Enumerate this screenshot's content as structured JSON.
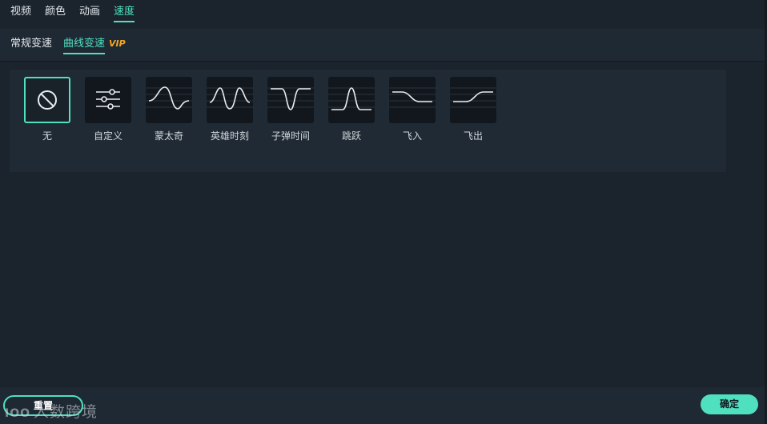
{
  "top_tabs": [
    {
      "label": "视频"
    },
    {
      "label": "颜色"
    },
    {
      "label": "动画"
    },
    {
      "label": "速度"
    }
  ],
  "sub_tabs": [
    {
      "label": "常规变速"
    },
    {
      "label": "曲线变速"
    }
  ],
  "vip_badge": "VIP",
  "presets": [
    {
      "label": "无",
      "icon": "none-icon"
    },
    {
      "label": "自定义",
      "icon": "sliders-icon"
    },
    {
      "label": "蒙太奇",
      "icon": "curve-montage-icon"
    },
    {
      "label": "英雄时刻",
      "icon": "curve-hero-icon"
    },
    {
      "label": "子弹时间",
      "icon": "curve-bullet-icon"
    },
    {
      "label": "跳跃",
      "icon": "curve-jump-icon"
    },
    {
      "label": "飞入",
      "icon": "curve-flyin-icon"
    },
    {
      "label": "飞出",
      "icon": "curve-flyout-icon"
    }
  ],
  "footer": {
    "reset_label": "重置",
    "confirm_label": "确定"
  },
  "watermark": {
    "logo": "IOO",
    "text": "人数跨境"
  },
  "colors": {
    "accent": "#4fe0c0",
    "vip": "#f5a623",
    "background": "#1b232c"
  }
}
